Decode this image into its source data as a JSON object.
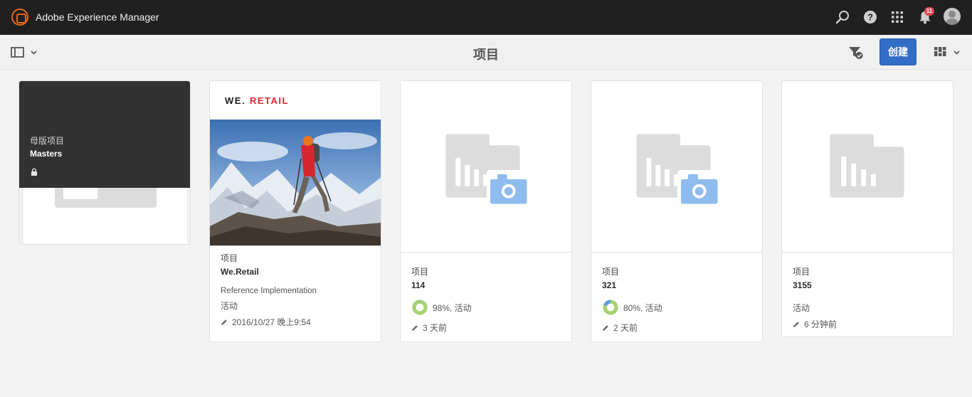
{
  "shell": {
    "app_title": "Adobe Experience Manager",
    "notification_count": "11",
    "icons": [
      "adobe-logo-icon",
      "search-icon",
      "help-icon",
      "apps-grid-icon",
      "bell-icon",
      "user-avatar-icon"
    ]
  },
  "actionbar": {
    "page_title": "项目",
    "create_label": "创建",
    "icons": [
      "rail-toggle-icon",
      "filter-icon",
      "view-switcher-icon"
    ]
  },
  "colors": {
    "shell_bg": "#202020",
    "accent": "#326ec8",
    "donut_green": "#a7d36e",
    "donut_blue": "#5b9fd9",
    "camera_blue": "#8fbcef",
    "brand_red": "#e0242d"
  },
  "cards": [
    {
      "id": "masters",
      "context": "母版项目",
      "title": "Masters",
      "icons": [
        "lock-icon"
      ]
    },
    {
      "id": "we-retail",
      "brand_prefix": "WE.",
      "brand_suffix": "RETAIL",
      "context": "项目",
      "title": "We.Retail",
      "description": "Reference Implementation",
      "status": "活动",
      "modified": "2016/10/27 晚上9:54"
    },
    {
      "id": "114",
      "context": "项目",
      "title": "114",
      "progress_label": "98%, 活动",
      "progress_fraction": 0.98,
      "modified": "3 天前"
    },
    {
      "id": "321",
      "context": "项目",
      "title": "321",
      "progress_label": "80%, 活动",
      "progress_fraction": 0.8,
      "modified": "2 天前"
    },
    {
      "id": "3155",
      "context": "项目",
      "title": "3155",
      "status": "活动",
      "modified": "6 分钟前"
    }
  ]
}
